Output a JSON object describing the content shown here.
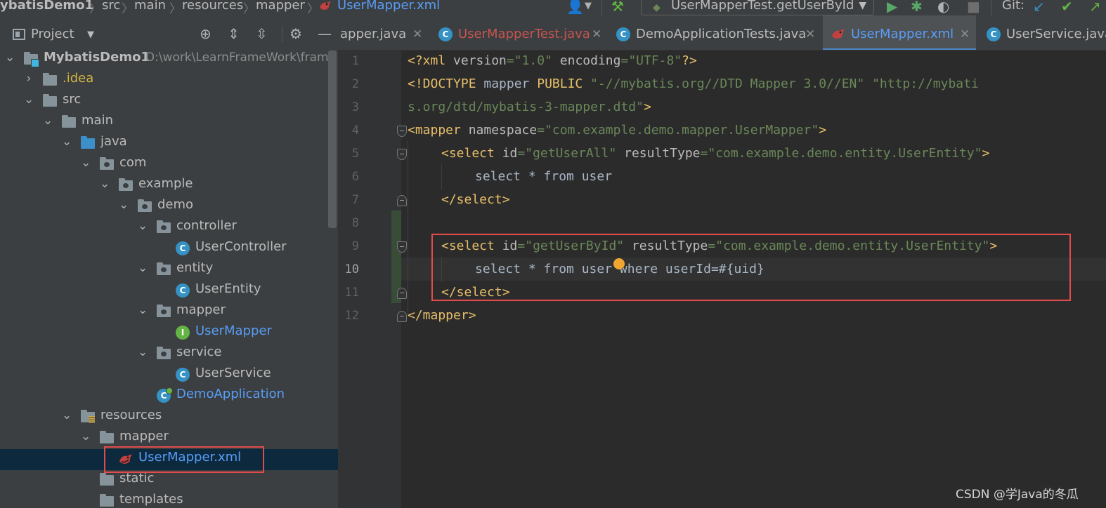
{
  "breadcrumb": {
    "project": "ybatisDemo1",
    "items": [
      "src",
      "main",
      "resources",
      "mapper"
    ],
    "file": "UserMapper.xml"
  },
  "toolbar": {
    "run_config": "UserMapperTest.getUserById",
    "git_label": "Git:"
  },
  "project_panel": {
    "title": "Project",
    "tree": [
      {
        "label": "MybatisDemo1",
        "path": "D:\\work\\LearnFrameWork\\frame"
      },
      {
        "label": ".idea"
      },
      {
        "label": "src"
      },
      {
        "label": "main"
      },
      {
        "label": "java"
      },
      {
        "label": "com"
      },
      {
        "label": "example"
      },
      {
        "label": "demo"
      },
      {
        "label": "controller"
      },
      {
        "label": "UserController"
      },
      {
        "label": "entity"
      },
      {
        "label": "UserEntity"
      },
      {
        "label": "mapper"
      },
      {
        "label": "UserMapper"
      },
      {
        "label": "service"
      },
      {
        "label": "UserService"
      },
      {
        "label": "DemoApplication"
      },
      {
        "label": "resources"
      },
      {
        "label": "mapper"
      },
      {
        "label": "UserMapper.xml"
      },
      {
        "label": "static"
      },
      {
        "label": "templates"
      }
    ]
  },
  "tabs": [
    {
      "label": "apper.java"
    },
    {
      "label": "UserMapperTest.java"
    },
    {
      "label": "DemoApplicationTests.java"
    },
    {
      "label": "UserMapper.xml"
    },
    {
      "label": "UserService.java"
    }
  ],
  "editor": {
    "line_numbers": [
      "1",
      "2",
      "3",
      "4",
      "5",
      "6",
      "7",
      "8",
      "9",
      "10",
      "11",
      "12"
    ],
    "current_line": "10",
    "code": {
      "l1": {
        "a": "<?xml ",
        "b": "version",
        "c": "=",
        "d": "\"1.0\"",
        "e": " ",
        "f": "encoding",
        "g": "=",
        "h": "\"UTF-8\"",
        "i": "?>"
      },
      "l2": {
        "a": "<!DOCTYPE ",
        "b": "mapper ",
        "c": "PUBLIC ",
        "d": "\"-//mybatis.org//DTD Mapper 3.0//EN\"",
        "e": " ",
        "f": "\"http://mybati"
      },
      "l3": {
        "a": "s.org/dtd/mybatis-3-mapper.dtd\"",
        "b": ">"
      },
      "l4": {
        "a": "<mapper ",
        "b": "namespace",
        "c": "=",
        "d": "\"com.example.demo.mapper.UserMapper\"",
        "e": ">"
      },
      "l5": {
        "a": "<select ",
        "b": "id",
        "c": "=",
        "d": "\"getUserAll\"",
        "e": " ",
        "f": "resultType",
        "g": "=",
        "h": "\"com.example.demo.entity.UserEntity\"",
        "i": ">"
      },
      "l6": {
        "a": "select * from user"
      },
      "l7": {
        "a": "</select>"
      },
      "l9": {
        "a": "<select ",
        "b": "id",
        "c": "=",
        "d": "\"getUserById\"",
        "e": " ",
        "f": "resultType",
        "g": "=",
        "h": "\"com.example.demo.entity.UserEntity\"",
        "i": ">"
      },
      "l10": {
        "a": "select * from user where userId=#{uid}"
      },
      "l11": {
        "a": "</select>"
      },
      "l12": {
        "a": "</mapper>"
      }
    }
  },
  "watermark": "CSDN @学Java的冬瓜",
  "colors": {
    "highlight_box": "#e24b4b",
    "xml_tag": "#e8bf6a",
    "xml_value": "#6a8759",
    "selection": "#0d293e",
    "accent": "#4a88c7"
  }
}
